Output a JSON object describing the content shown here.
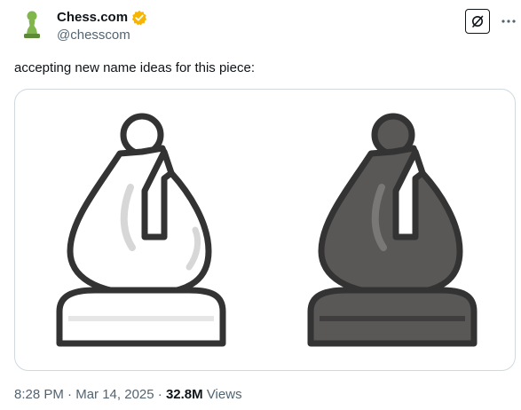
{
  "author": {
    "display_name": "Chess.com",
    "handle": "@chesscom",
    "verified": true,
    "verified_badge_color": "#f7b500",
    "avatar_icon": "pawn-icon",
    "avatar_color": "#81b64c"
  },
  "header_actions": {
    "grok_icon": "grok-icon",
    "more_icon": "more-options-icon"
  },
  "tweet": {
    "text": "accepting new name ideas for this piece:"
  },
  "media": {
    "type": "image",
    "pieces": [
      "white-bishop-icon",
      "black-bishop-icon"
    ]
  },
  "meta": {
    "time": "8:28 PM",
    "separator": "·",
    "date": "Mar 14, 2025",
    "views_count": "32.8M",
    "views_label": "Views"
  }
}
